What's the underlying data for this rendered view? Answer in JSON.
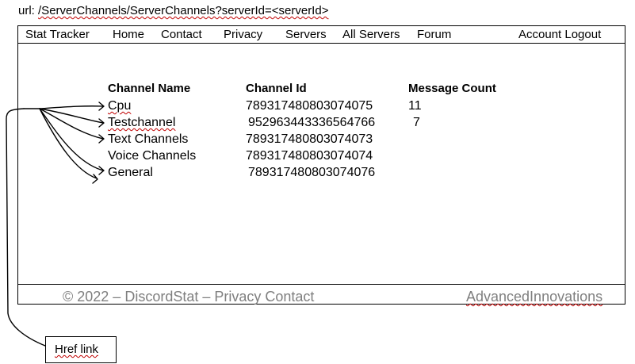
{
  "url_line": {
    "prefix": "url: ",
    "path": "/ServerChannels/ServerChannels?serverId=<serverId>"
  },
  "nav": {
    "brand": "Stat Tracker",
    "items": [
      "Home",
      "Contact",
      "Privacy",
      "Servers",
      "All Servers",
      "Forum"
    ],
    "account": "Account Logout"
  },
  "table": {
    "headers": [
      "Channel Name",
      "Channel Id",
      "Message Count"
    ],
    "rows": [
      {
        "name": "Cpu",
        "id": "789317480803074075",
        "count": "11"
      },
      {
        "name": "Testchannel",
        "id": "952963443336564766",
        "count": "7"
      },
      {
        "name": "Text Channels",
        "id": "789317480803074073",
        "count": ""
      },
      {
        "name": "Voice Channels",
        "id": "789317480803074074",
        "count": ""
      },
      {
        "name": "General",
        "id": "789317480803074076",
        "count": ""
      }
    ]
  },
  "footer": {
    "left": "© 2022 – DiscordStat – Privacy Contact",
    "right": "AdvancedInnovations"
  },
  "annotation": {
    "label": "Href link"
  }
}
